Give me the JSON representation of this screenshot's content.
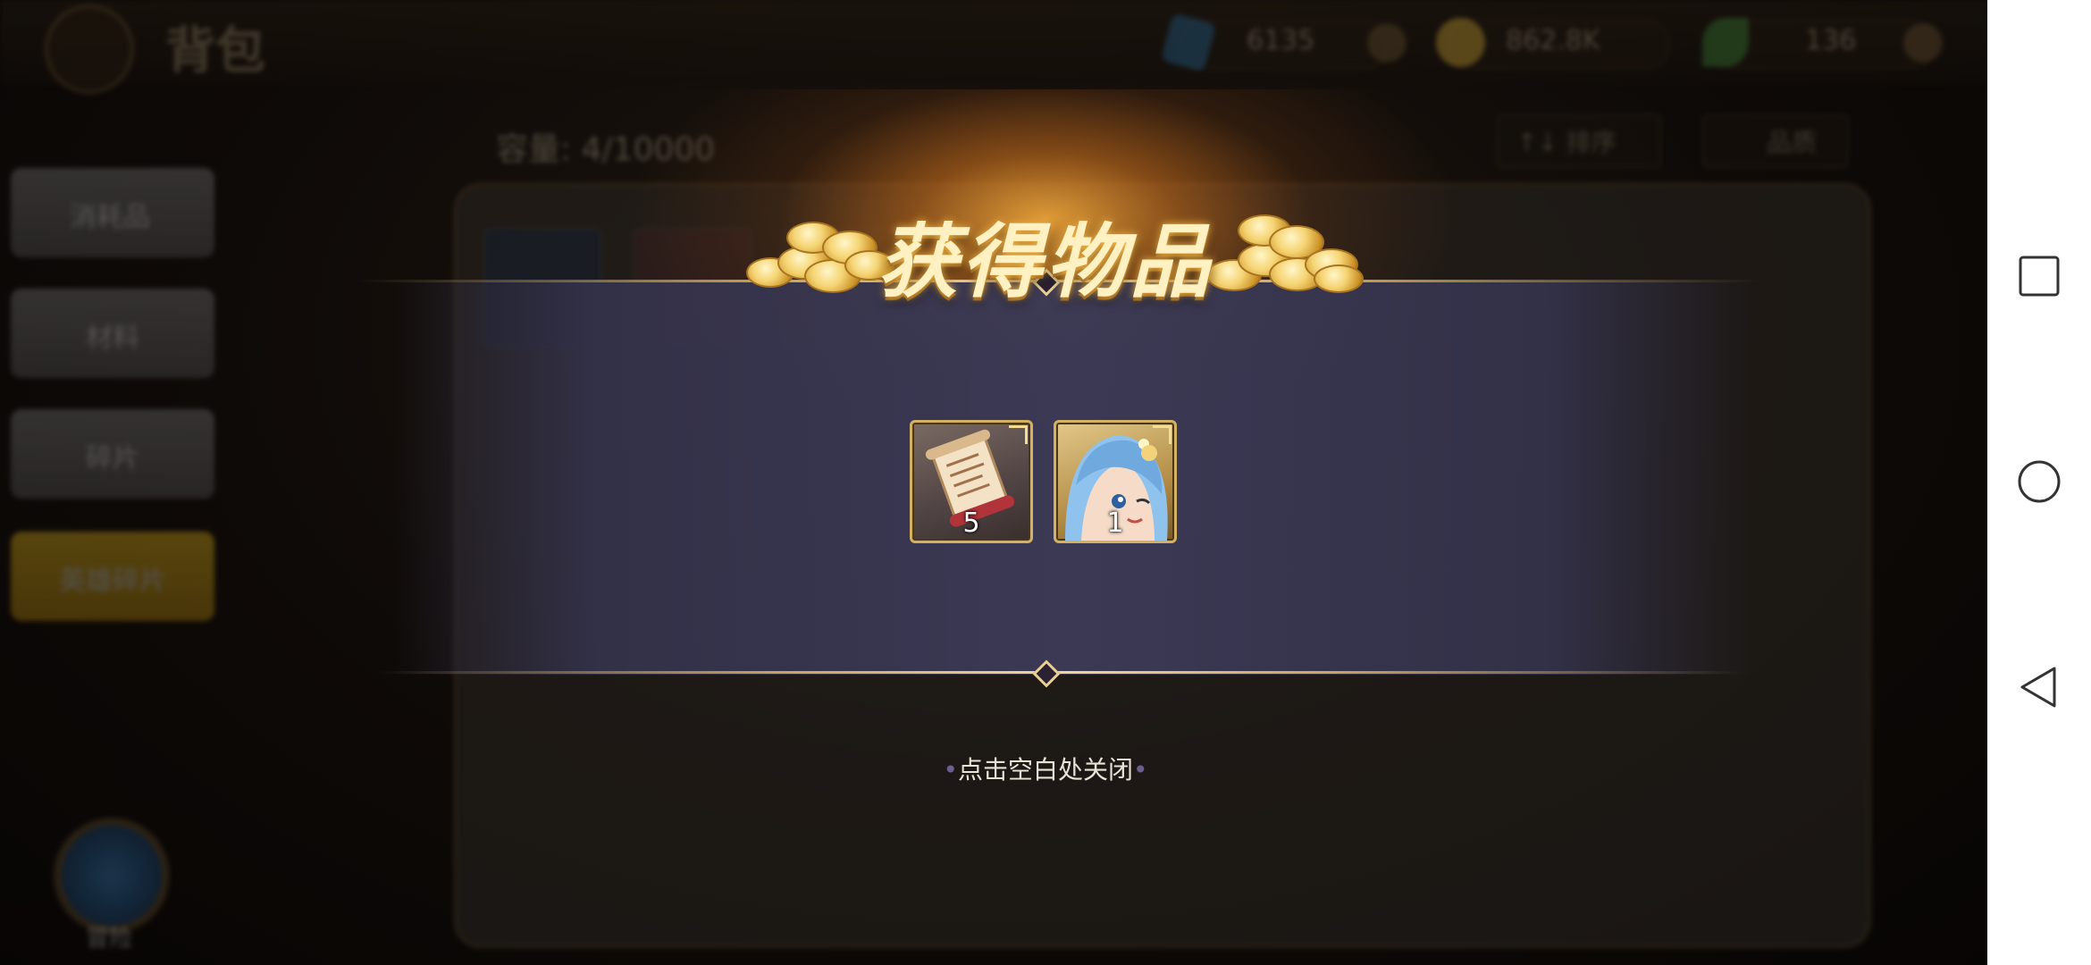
{
  "background": {
    "page_title": "背包",
    "resources": [
      {
        "icon": "gem-icon",
        "value": "6135"
      },
      {
        "icon": "gold-coin-icon",
        "value": "862.8K"
      },
      {
        "icon": "leaf-icon",
        "value": "136"
      }
    ],
    "capacity_text": "容量: 4/10000",
    "sort_label": "↑↓ 排序",
    "filter_label": "品质",
    "side_tabs": [
      "消耗品",
      "材料",
      "碎片",
      "英雄碎片"
    ],
    "compass_label": "冒险"
  },
  "modal": {
    "title": "获得物品",
    "items": [
      {
        "icon": "scroll-icon",
        "count": "5"
      },
      {
        "icon": "hero-portrait-icon",
        "count": "1"
      }
    ],
    "close_hint": "点击空白处关闭"
  },
  "colors": {
    "title_glow": "#ffbe4a",
    "item_border": "#d3b062",
    "band": "#3c3a56"
  },
  "navbar": {
    "buttons": [
      "recent-apps",
      "home",
      "back"
    ]
  }
}
